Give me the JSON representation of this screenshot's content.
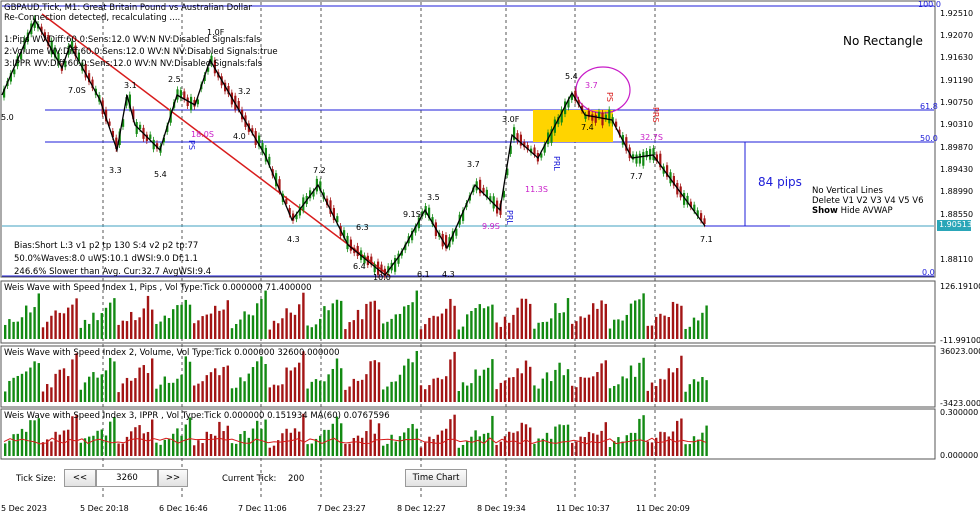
{
  "header": {
    "symbol_line": "GBPAUD,Tick, M1:  Great Britain Pound vs Australian Dollar",
    "status_line": "Re-Connection detected, recalculating ....",
    "settings": [
      "1:Pips     WV:Diff:60.0:Sens:12.0 WV:N NV:Disabled Signals:fals",
      "2:Volume WV:Diff:60.0:Sens:12.0 WV:N NV:Disabled Signals:true",
      "3:IPPR    WV:Diff:60.0:Sens:12.0 WV:N NV:Disabled Signals:fals"
    ]
  },
  "main_chart": {
    "price_axis": [
      "1.92510",
      "1.92070",
      "1.91630",
      "1.91190",
      "1.90750",
      "1.90310",
      "1.89870",
      "1.89430",
      "1.88990",
      "1.88550",
      "1.88110"
    ],
    "current_price": "1.90513",
    "fib_levels": [
      {
        "label": "100.0"
      },
      {
        "label": "61.8"
      },
      {
        "label": "50.0"
      },
      {
        "label": "0.0"
      }
    ],
    "no_rectangle": "No Rectangle",
    "pips_label": "84 pips",
    "controls": {
      "line1": "No Vertical Lines",
      "line2": "Delete V1 V2 V3 V4 V5 V6",
      "show": "Show",
      "hide_avwap": " Hide AVWAP"
    },
    "stats": [
      "Bias:Short L:3 v1 p2 tp 130 S:4 v2 p2 tp:77",
      "50.0%Waves:8.0 uWS:10.1 dWSI:9.0 Df:1.1",
      "246.6% Slower than Avg. Cur:32.7 AvgWSI:9.4"
    ],
    "wave_labels": [
      {
        "t": "5.0"
      },
      {
        "t": "7.0S"
      },
      {
        "t": "3.1"
      },
      {
        "t": "2.5"
      },
      {
        "t": "1.0F"
      },
      {
        "t": "3.2"
      },
      {
        "t": "3.3"
      },
      {
        "t": "5.4"
      },
      {
        "t": "4.0"
      },
      {
        "t": "7.2"
      },
      {
        "t": "4.3"
      },
      {
        "t": "6.3"
      },
      {
        "t": "9.1S"
      },
      {
        "t": "3.5"
      },
      {
        "t": "6.4"
      },
      {
        "t": "10.0"
      },
      {
        "t": "6.1"
      },
      {
        "t": "4.3"
      },
      {
        "t": "3.7"
      },
      {
        "t": "3.0F"
      },
      {
        "t": "5.4"
      },
      {
        "t": "7.4"
      },
      {
        "t": "7.7"
      },
      {
        "t": "7.1"
      }
    ],
    "magenta_labels": [
      {
        "t": "18.0S"
      },
      {
        "t": "9.9S"
      },
      {
        "t": "11.3S"
      },
      {
        "t": "3.7"
      },
      {
        "t": "32.7S"
      }
    ],
    "signals": [
      {
        "t": "PS"
      },
      {
        "t": "PRL"
      },
      {
        "t": "PRL"
      },
      {
        "t": "PRS"
      },
      {
        "t": "PS"
      }
    ]
  },
  "indicators": [
    {
      "title": "Weis Wave with Speed Index 1, Pips    , Vol Type:Tick 0.000000 71.400000",
      "top_label": "126.191000",
      "bottom_label": "-11.991000"
    },
    {
      "title": "Weis Wave with Speed Index 2, Volume, Vol Type:Tick 0.000000 32600.000000",
      "top_label": "36023.000000",
      "bottom_label": "-3423.000000"
    },
    {
      "title": "Weis Wave with Speed Index 3, IPPR    , Vol Type:Tick 0.000000 0.151934 MA(60) 0.0767596",
      "top_label": "0.300000",
      "bottom_label": "0.000000"
    }
  ],
  "toolbar": {
    "tick_size_label": "Tick Size:",
    "prev": "<<",
    "tick_value": "3260",
    "next": ">>",
    "current_tick_label": "Current Tick:",
    "current_tick_value": "200",
    "time_chart": "Time Chart"
  },
  "time_axis": [
    "5 Dec 2023",
    "5 Dec 20:18",
    "6 Dec 16:46",
    "7 Dec 11:06",
    "7 Dec 23:27",
    "8 Dec 12:27",
    "8 Dec 19:34",
    "11 Dec 10:37",
    "11 Dec 20:09"
  ],
  "colors": {
    "up": "#138a13",
    "down": "#a31515",
    "fib": "#1c1cd8",
    "trend": "#d81c1c",
    "magenta": "#c81cc8",
    "zone": "#ffd400"
  }
}
